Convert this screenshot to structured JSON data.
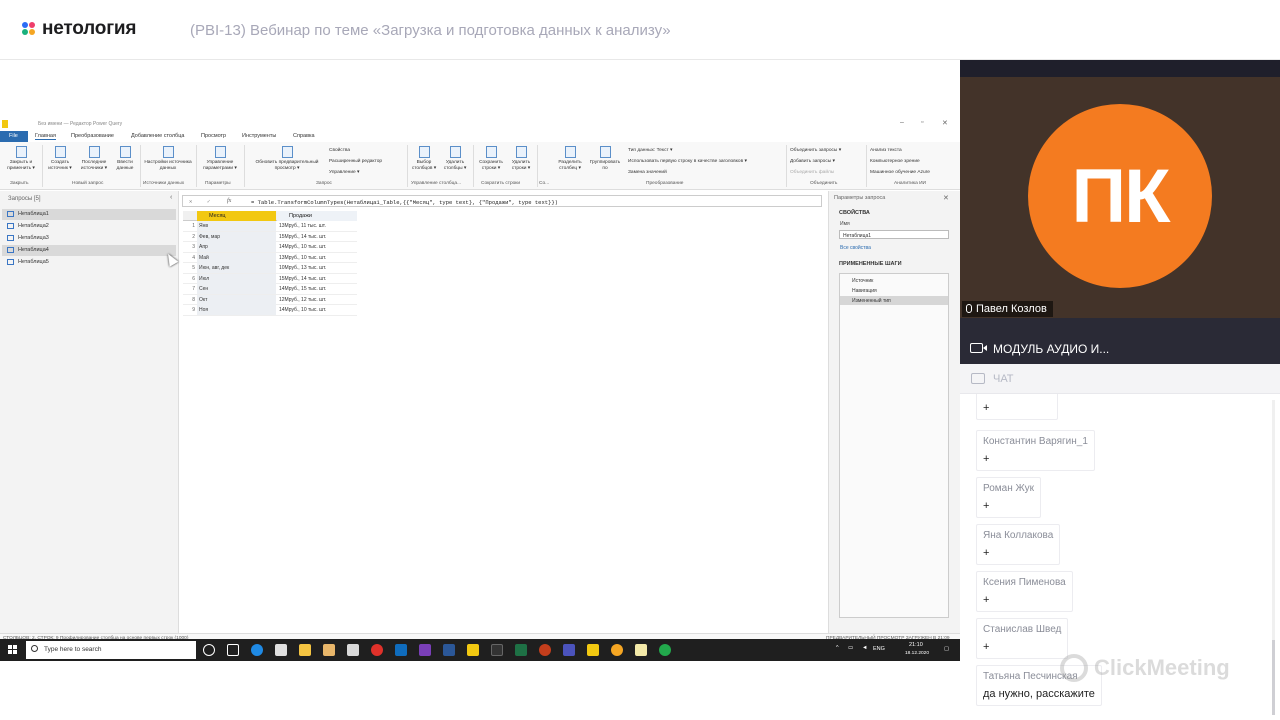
{
  "header": {
    "logo_text": "нетология",
    "webinar_title": "(PBI-13) Вебинар по теме «Загрузка и подготовка данных к анализу»",
    "logo_colors": [
      "#2b6cf5",
      "#ef3e6b",
      "#19b17d",
      "#f5a623"
    ]
  },
  "powerquery": {
    "window_title": "Без имени — Редактор Power Query",
    "tabs": [
      "File",
      "Главная",
      "Преобразование",
      "Добавление столбца",
      "Просмотр",
      "Инструменты",
      "Справка"
    ],
    "ribbon": {
      "buttons": [
        {
          "label": "Закрыть и применить ▾"
        },
        {
          "label": "Создать источник ▾"
        },
        {
          "label": "Последние источники ▾"
        },
        {
          "label": "Ввести данные"
        },
        {
          "label": "Настройки источника данных"
        },
        {
          "label": "Управление параметрами ▾"
        },
        {
          "label": "Обновить предварительный просмотр ▾"
        },
        {
          "label": "Выбор столбцов ▾"
        },
        {
          "label": "Удалить столбцы ▾"
        },
        {
          "label": "Сохранить строки ▾"
        },
        {
          "label": "Удалить строки ▾"
        },
        {
          "label": "Разделить столбец ▾"
        },
        {
          "label": "Группировать по"
        }
      ],
      "query_lines": [
        "Свойства",
        "Расширенный редактор",
        "Управление ▾"
      ],
      "transform_lines": [
        "Тип данных: Текст ▾",
        "Использовать первую строку в качестве заголовков ▾",
        "Замена значений"
      ],
      "combine_lines": [
        "Объединить запросы ▾",
        "Добавить запросы ▾",
        "Объединить файлы"
      ],
      "ai_lines": [
        "Анализ текста",
        "Компьютерное зрение",
        "Машинное обучение Azure"
      ],
      "groups": [
        "Закрыть",
        "Новый запрос",
        "Источники данных",
        "Параметры",
        "Запрос",
        "Управление столбца...",
        "Сократить строки",
        "Со...",
        "Преобразование",
        "Объединить",
        "Аналитика ИИ"
      ]
    },
    "queries_header": "Запросы [5]",
    "queries": [
      "Нетаблица1",
      "Нетаблица2",
      "Нетаблица3",
      "Нетаблица4",
      "Нетаблица5"
    ],
    "formula": "= Table.TransformColumnTypes(Нетаблица1_Table,{{\"Месяц\", type text}, {\"Продажи\", type text}})",
    "columns": [
      "Месяц",
      "Продажи"
    ],
    "rows": [
      {
        "n": "1",
        "month": "Янв",
        "sales": "13Мруб., 11 тыс. шт."
      },
      {
        "n": "2",
        "month": "Фев, мар",
        "sales": "15Мруб., 14 тыс. шт."
      },
      {
        "n": "3",
        "month": "Апр",
        "sales": "14Мруб., 10 тыс. шт."
      },
      {
        "n": "4",
        "month": "Май",
        "sales": "13Мруб., 10 тыс. шт."
      },
      {
        "n": "5",
        "month": "Июн, авг, дек",
        "sales": "10Мруб., 13 тыс. шт."
      },
      {
        "n": "6",
        "month": "Июл",
        "sales": "15Мруб., 14 тыс. шт."
      },
      {
        "n": "7",
        "month": "Сен",
        "sales": "14Мруб., 15 тыс. шт."
      },
      {
        "n": "8",
        "month": "Окт",
        "sales": "12Мруб., 12 тыс. шт."
      },
      {
        "n": "9",
        "month": "Ноя",
        "sales": "14Мруб., 10 тыс. шт."
      }
    ],
    "settings": {
      "header": "Параметры запроса",
      "properties": "СВОЙСТВА",
      "name_label": "Имя",
      "name_value": "Нетаблица1",
      "all_props": "Все свойства",
      "steps_header": "ПРИМЕНЕННЫЕ ШАГИ",
      "steps": [
        "Источник",
        "Навигация",
        "Измененный тип"
      ]
    },
    "status_left": "СТОЛБЦОВ: 2, СТРОК: 9     Профилирование столбца на основе первых строк (1000)",
    "status_right": "ПРЕДВАРИТЕЛЬНЫЙ ПРОСМОТР ЗАГРУЖЕН В 21:09",
    "taskbar": {
      "search_placeholder": "Type here to search",
      "lang": "ENG",
      "time": "21:10",
      "date": "18.12.2020"
    }
  },
  "video": {
    "initials": "ПК",
    "presenter": "Павел Козлов",
    "avatar_color": "#f47b20"
  },
  "module": {
    "label": "МОДУЛЬ АУДИО И..."
  },
  "chat": {
    "label": "ЧАТ",
    "messages": [
      {
        "author": "",
        "text": "+"
      },
      {
        "author": "Константин Варягин_1",
        "text": "+"
      },
      {
        "author": "Роман Жук",
        "text": "+"
      },
      {
        "author": "Яна Коллакова",
        "text": "+"
      },
      {
        "author": "Ксения Пименова",
        "text": "+"
      },
      {
        "author": "Станислав Швед",
        "text": "+"
      },
      {
        "author": "Татьяна Песчинская",
        "text": "да нужно, расскажите"
      }
    ]
  },
  "watermark": "ClickMeeting"
}
